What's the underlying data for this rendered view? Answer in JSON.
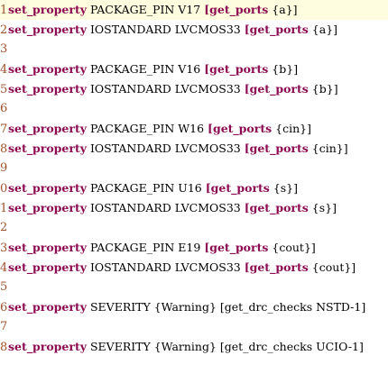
{
  "editor": {
    "active_line": 1,
    "lines": [
      {
        "num": "1",
        "parts": [
          {
            "t": "set_property",
            "k": 1
          },
          {
            "t": " PACKAGE_PIN V17 ",
            "k": 0
          },
          {
            "t": "[get_ports",
            "k": 1
          },
          {
            "t": " {a}]",
            "k": 0
          }
        ]
      },
      {
        "num": "2",
        "parts": [
          {
            "t": "set_property",
            "k": 1
          },
          {
            "t": " IOSTANDARD LVCMOS33 ",
            "k": 0
          },
          {
            "t": "[get_ports",
            "k": 1
          },
          {
            "t": " {a}]",
            "k": 0
          }
        ]
      },
      {
        "num": "3",
        "parts": []
      },
      {
        "num": "4",
        "parts": [
          {
            "t": "set_property",
            "k": 1
          },
          {
            "t": " PACKAGE_PIN V16 ",
            "k": 0
          },
          {
            "t": "[get_ports",
            "k": 1
          },
          {
            "t": " {b}]",
            "k": 0
          }
        ]
      },
      {
        "num": "5",
        "parts": [
          {
            "t": "set_property",
            "k": 1
          },
          {
            "t": " IOSTANDARD LVCMOS33 ",
            "k": 0
          },
          {
            "t": "[get_ports",
            "k": 1
          },
          {
            "t": " {b}]",
            "k": 0
          }
        ]
      },
      {
        "num": "6",
        "parts": []
      },
      {
        "num": "7",
        "parts": [
          {
            "t": "set_property",
            "k": 1
          },
          {
            "t": " PACKAGE_PIN W16 ",
            "k": 0
          },
          {
            "t": "[get_ports",
            "k": 1
          },
          {
            "t": " {cin}]",
            "k": 0
          }
        ]
      },
      {
        "num": "8",
        "parts": [
          {
            "t": "set_property",
            "k": 1
          },
          {
            "t": " IOSTANDARD LVCMOS33 ",
            "k": 0
          },
          {
            "t": "[get_ports",
            "k": 1
          },
          {
            "t": " {cin}]",
            "k": 0
          }
        ]
      },
      {
        "num": "9",
        "parts": []
      },
      {
        "num": "0",
        "parts": [
          {
            "t": "set_property",
            "k": 1
          },
          {
            "t": " PACKAGE_PIN U16 ",
            "k": 0
          },
          {
            "t": "[get_ports",
            "k": 1
          },
          {
            "t": " {s}]",
            "k": 0
          }
        ]
      },
      {
        "num": "1",
        "parts": [
          {
            "t": "set_property",
            "k": 1
          },
          {
            "t": " IOSTANDARD LVCMOS33 ",
            "k": 0
          },
          {
            "t": "[get_ports",
            "k": 1
          },
          {
            "t": " {s}]",
            "k": 0
          }
        ]
      },
      {
        "num": "2",
        "parts": []
      },
      {
        "num": "3",
        "parts": [
          {
            "t": "set_property",
            "k": 1
          },
          {
            "t": " PACKAGE_PIN E19 ",
            "k": 0
          },
          {
            "t": "[get_ports",
            "k": 1
          },
          {
            "t": " {cout}]",
            "k": 0
          }
        ]
      },
      {
        "num": "4",
        "parts": [
          {
            "t": "set_property",
            "k": 1
          },
          {
            "t": " IOSTANDARD LVCMOS33 ",
            "k": 0
          },
          {
            "t": "[get_ports",
            "k": 1
          },
          {
            "t": " {cout}]",
            "k": 0
          }
        ]
      },
      {
        "num": "5",
        "parts": []
      },
      {
        "num": "6",
        "parts": [
          {
            "t": "set_property",
            "k": 1
          },
          {
            "t": " SEVERITY {Warning} [get_drc_checks NSTD-1]",
            "k": 0
          }
        ]
      },
      {
        "num": "7",
        "parts": []
      },
      {
        "num": "8",
        "parts": [
          {
            "t": "set_property",
            "k": 1
          },
          {
            "t": " SEVERITY {Warning} [get_drc_checks UCIO-1]",
            "k": 0
          }
        ]
      }
    ]
  },
  "colors": {
    "keyword": "#8b0a50",
    "line_number": "#a0522d",
    "active_line_bg": "#fffde0"
  }
}
